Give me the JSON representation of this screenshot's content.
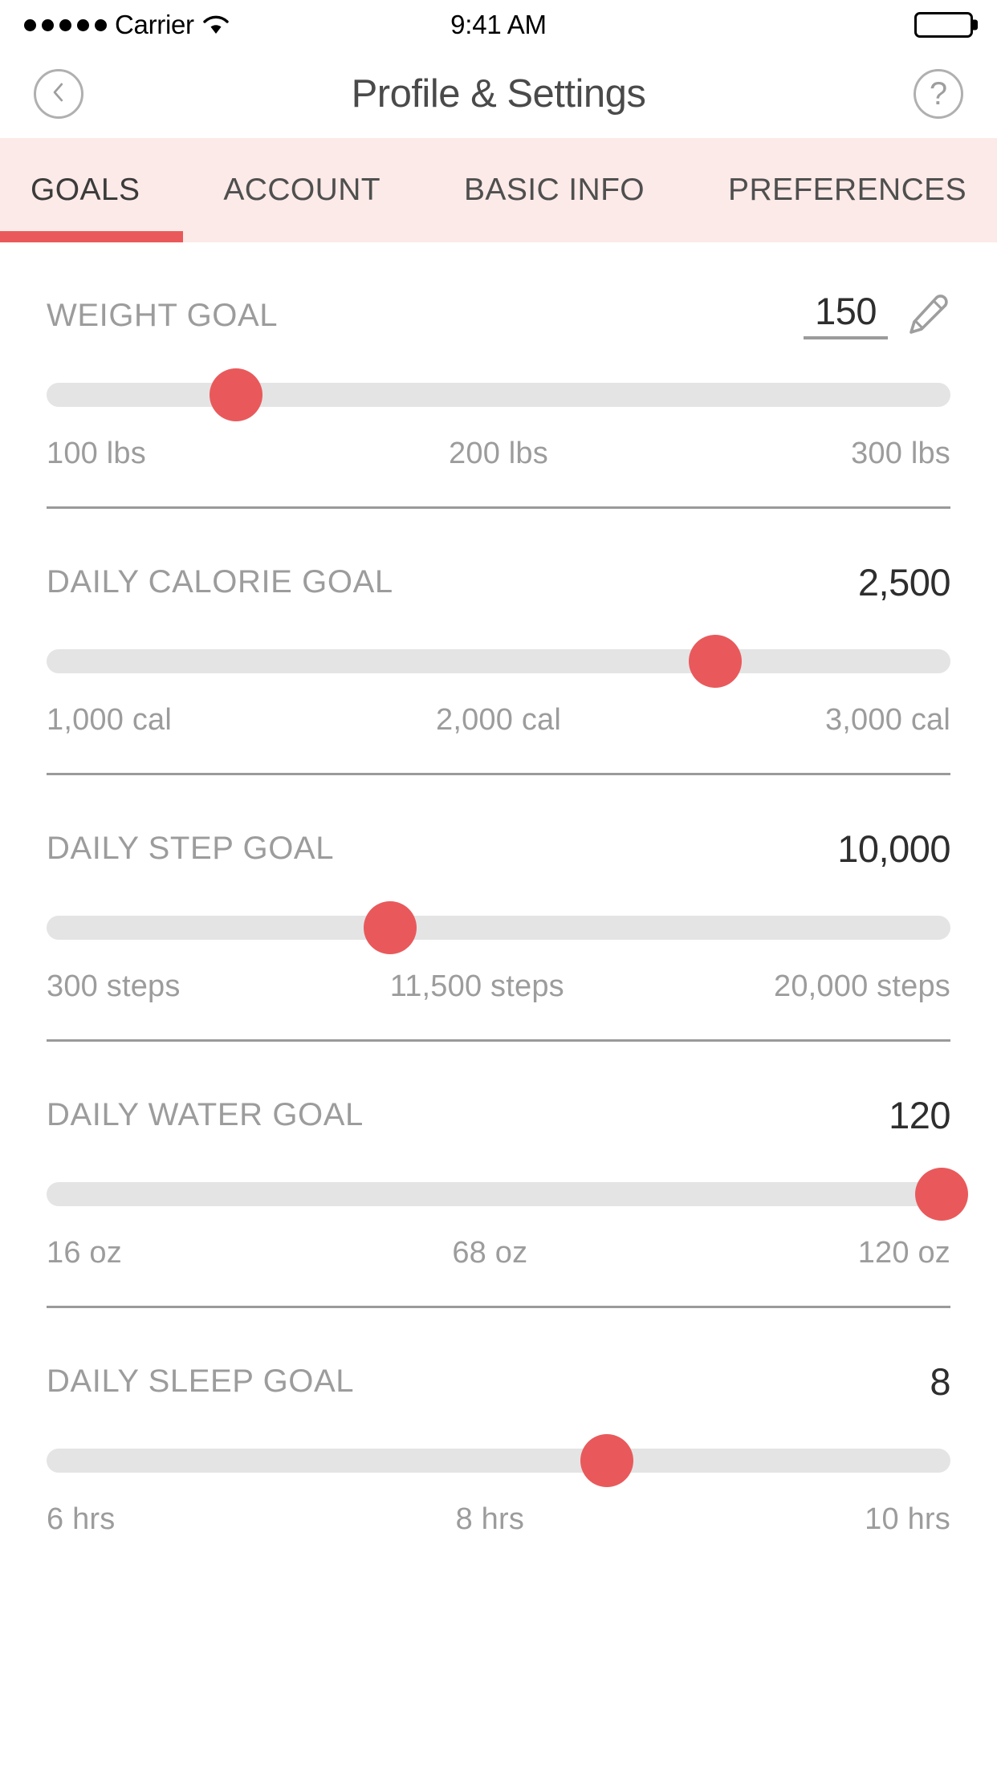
{
  "status_bar": {
    "signal_dots": 5,
    "carrier": "Carrier",
    "wifi_icon": "wifi-icon",
    "time": "9:41 AM",
    "battery_icon": "battery-full-icon"
  },
  "nav_bar": {
    "back_icon": "chevron-left-icon",
    "title": "Profile & Settings",
    "help_icon": "question-mark-icon",
    "help_label": "?"
  },
  "tabs": {
    "active_index": 0,
    "items": [
      {
        "label": "GOALS"
      },
      {
        "label": "ACCOUNT"
      },
      {
        "label": "BASIC INFO"
      },
      {
        "label": "PREFERENCES"
      }
    ]
  },
  "theme": {
    "accent": "#e9595b",
    "tab_bar_bg": "#fceae8",
    "track": "#e4e4e4",
    "label_gray": "#9c9c9c",
    "value_dark": "#2e2e2e"
  },
  "goals": [
    {
      "label": "WEIGHT GOAL",
      "value": "150",
      "editable": true,
      "edit_icon": "pencil-icon",
      "thumb_percent": 21,
      "scale": [
        "100 lbs",
        "200 lbs",
        "300 lbs"
      ]
    },
    {
      "label": "DAILY CALORIE GOAL",
      "value": "2,500",
      "editable": false,
      "thumb_percent": 74,
      "scale": [
        "1,000 cal",
        "2,000 cal",
        "3,000 cal"
      ]
    },
    {
      "label": "DAILY STEP GOAL",
      "value": "10,000",
      "editable": false,
      "thumb_percent": 38,
      "scale": [
        "300 steps",
        "11,500 steps",
        "20,000 steps"
      ]
    },
    {
      "label": "DAILY WATER GOAL",
      "value": "120",
      "editable": false,
      "thumb_percent": 99,
      "scale": [
        "16 oz",
        "68 oz",
        "120 oz"
      ]
    },
    {
      "label": "DAILY SLEEP GOAL",
      "value": "8",
      "editable": false,
      "thumb_percent": 62,
      "scale": [
        "6 hrs",
        "8 hrs",
        "10 hrs"
      ]
    }
  ]
}
